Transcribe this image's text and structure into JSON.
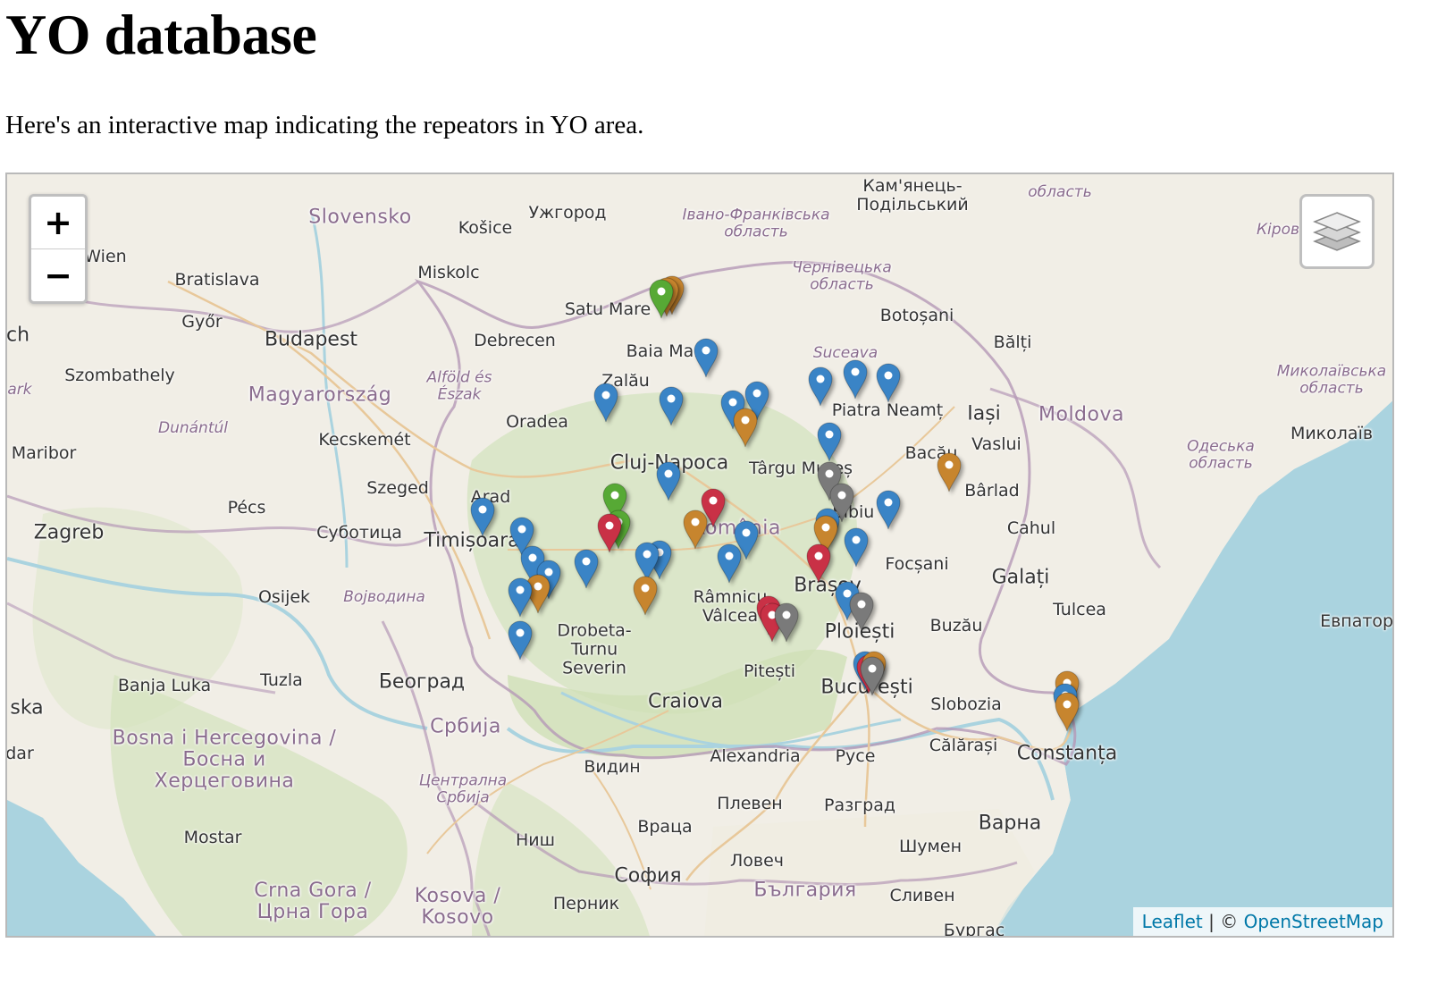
{
  "page": {
    "title": "YO database",
    "intro": "Here's an interactive map indicating the repeators in YO area."
  },
  "map": {
    "zoom_in_label": "+",
    "zoom_out_label": "−",
    "layers_icon": "layers-icon",
    "attribution": {
      "leaflet": "Leaflet",
      "separator": " | © ",
      "osm": "OpenStreetMap"
    },
    "marker_colors": {
      "blue": "#3a84c6",
      "orange": "#c7852e",
      "green": "#57a935",
      "red": "#c93146",
      "grey": "#7a7a7a"
    },
    "labels": {
      "wien": "Wien",
      "bratislava": "Bratislava",
      "slovensko": "Slovensko",
      "kosice": "Košice",
      "uzhorod": "Ужгород",
      "ivano": "Івано-Франківська\nобласть",
      "kamianets": "Кам'янець-\nПодільський",
      "oblast_top": "область",
      "chernivtsi": "Чернівецька\nобласть",
      "botosani": "Botoșani",
      "balti": "Bălți",
      "kirov": "Кіров",
      "mykolaiv_obl": "Миколаївська\nобласть",
      "mykolaiv": "Миколаїв",
      "odesa": "Одеська\nобласть",
      "miskolc": "Miskolc",
      "gyor": "Győr",
      "budapest": "Budapest",
      "debrecen": "Debrecen",
      "satu_mare": "Satu Mare",
      "baia_mare": "Baia Mare",
      "suceava": "Suceava",
      "szombathely": "Szombathely",
      "magyar": "Magyarország",
      "alfold": "Alföld és\nÉszak",
      "zalau": "Zalău",
      "oradea": "Oradea",
      "piatra": "Piatra Neamț",
      "iasi": "Iași",
      "moldova": "Moldova",
      "vaslui": "Vaslui",
      "bacau": "Bacău",
      "dunantul": "Dunántúl",
      "kecskemet": "Kecskemét",
      "cluj": "Cluj-Napoca",
      "targu": "Târgu Mureș",
      "barlad": "Bârlad",
      "maribor": "Maribor",
      "szeged": "Szeged",
      "arad": "Arad",
      "pecs": "Pécs",
      "romania": "România",
      "sibiu": "Sibiu",
      "zagreb": "Zagreb",
      "subotica": "Суботица",
      "timisoara": "Timișoara",
      "cahul": "Cahul",
      "focsani": "Focșani",
      "galati": "Galați",
      "osijek": "Osijek",
      "vojvodina": "Војводина",
      "ramnicu": "Râmnicu\nVâlcea",
      "brasov": "Brașov",
      "tulcea": "Tulcea",
      "drobeta": "Drobeta-\nTurnu\nSeverin",
      "ploiesti": "Ploiești",
      "buzau": "Buzău",
      "evpatoria": "Евпатория",
      "pitesti": "Pitești",
      "banja": "Banja Luka",
      "tuzla": "Tuzla",
      "beograd": "Београд",
      "bucuresti": "București",
      "craiova": "Craiova",
      "slobozia": "Slobozia",
      "srbija": "Србија",
      "bosna": "Bosna i Hercegovina /\nБосна и\nХерцеговина",
      "calarasi": "Călărași",
      "constanta": "Constanța",
      "alexandria": "Alexandria",
      "ruse": "Русе",
      "vidin": "Видин",
      "central_srb": "Централна\nСрбија",
      "pleven": "Плевен",
      "razgrad": "Разград",
      "varna": "Варна",
      "vratsa": "Враца",
      "nis": "Ниш",
      "shumen": "Шумен",
      "mostar": "Mostar",
      "lovech": "Ловеч",
      "sofia": "София",
      "bulgaria": "България",
      "sliven": "Сливен",
      "crna_gora": "Crna Gora /\nЦрна Гора",
      "kosovo": "Kosova /\nKosovo",
      "pernik": "Перник",
      "burgas": "Бургас",
      "dar": "dar",
      "ska": "ska",
      "ark": "ark",
      "ch": "ch"
    }
  }
}
